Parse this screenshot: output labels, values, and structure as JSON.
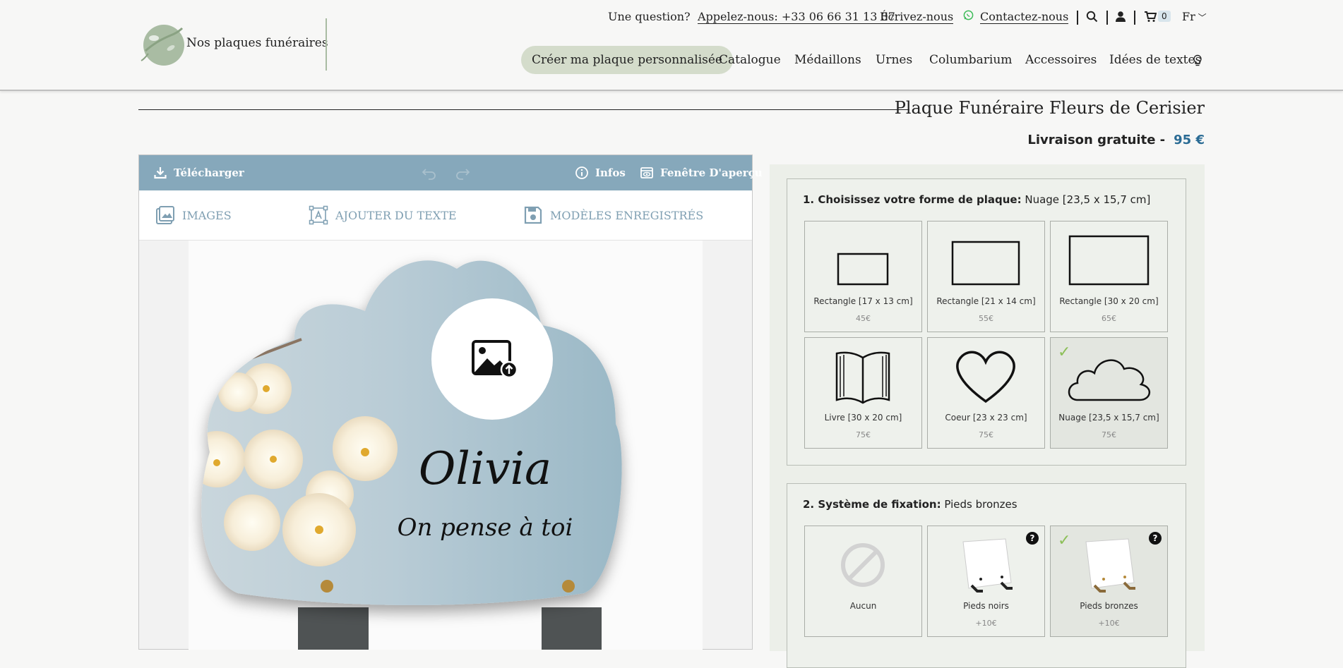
{
  "header": {
    "logo_text": "Nos plaques funéraires",
    "question": "Une question?",
    "phone": "Appelez-nous: +33 06 66 31 13 07",
    "email": "Écrivez-nous",
    "whatsapp": "Contactez-nous",
    "cart_count": "0",
    "language": "Fr"
  },
  "nav": {
    "items": [
      "Créer ma plaque personnalisée",
      "Catalogue",
      "Médaillons",
      "Urnes",
      "Columbarium",
      "Accessoires",
      "Idées de textes"
    ]
  },
  "product": {
    "title": "Plaque Funéraire Fleurs de Cerisier",
    "shipping": "Livraison gratuite -",
    "price": "95 €"
  },
  "editor": {
    "download": "Télécharger",
    "info": "Infos",
    "preview": "Fenêtre D'aperçu",
    "tabs": [
      "IMAGES",
      "AJOUTER DU TEXTE",
      "MODÈLES ENREGISTRÉS"
    ],
    "plaque_name": "Olivia",
    "plaque_text": "On pense à toi"
  },
  "shape_section": {
    "label": "1. Choisissez votre forme de plaque:",
    "selected": "Nuage [23,5 x 15,7 cm]",
    "options": [
      {
        "label": "Rectangle [17 x 13 cm]",
        "price": "45€",
        "icon": "rectangle-small-icon"
      },
      {
        "label": "Rectangle [21 x 14 cm]",
        "price": "55€",
        "icon": "rectangle-medium-icon"
      },
      {
        "label": "Rectangle [30 x 20 cm]",
        "price": "65€",
        "icon": "rectangle-large-icon"
      },
      {
        "label": "Livre [30 x 20 cm]",
        "price": "75€",
        "icon": "book-icon"
      },
      {
        "label": "Coeur [23 x 23 cm]",
        "price": "75€",
        "icon": "heart-icon"
      },
      {
        "label": "Nuage [23,5 x 15,7 cm]",
        "price": "75€",
        "icon": "cloud-icon"
      }
    ]
  },
  "fixing_section": {
    "label": "2. Système de fixation:",
    "selected": "Pieds bronzes",
    "options": [
      {
        "label": "Aucun",
        "price": "",
        "icon": "none-icon"
      },
      {
        "label": "Pieds noirs",
        "price": "+10€",
        "icon": "stand-black-icon"
      },
      {
        "label": "Pieds bronzes",
        "price": "+10€",
        "icon": "stand-bronze-icon"
      }
    ]
  },
  "colors": {
    "accent_green": "#8cbf58",
    "toolbar_blue": "#86a8bb",
    "price_blue": "#2a6b94",
    "nav_pill": "#d4dccb"
  }
}
